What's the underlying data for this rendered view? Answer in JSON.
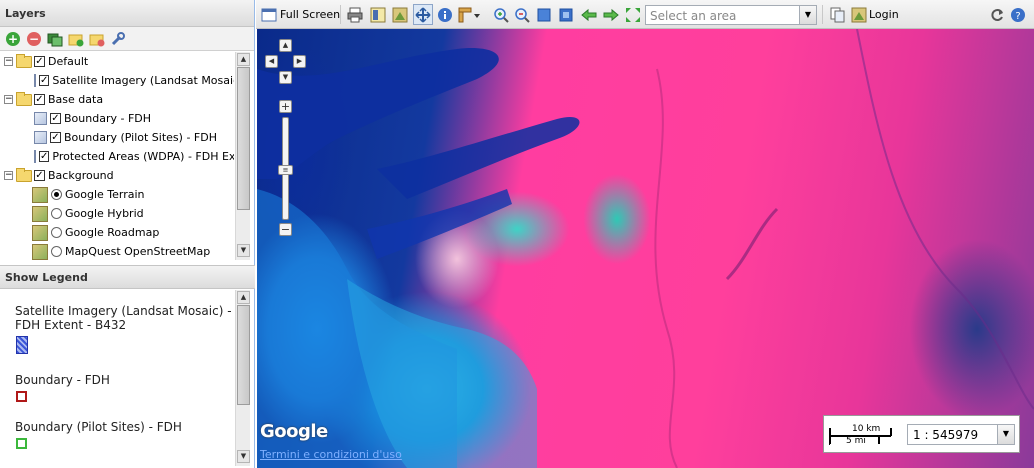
{
  "layers_panel": {
    "title": "Layers",
    "tree": {
      "default_group": "Default",
      "default_layer": "Satellite Imagery (Landsat Mosaic) - FDH Extent - B432",
      "base_group": "Base data",
      "base_layers": [
        "Boundary - FDH",
        "Boundary (Pilot Sites) - FDH",
        "Protected Areas (WDPA) - FDH Extent"
      ],
      "background_group": "Background",
      "background_layers": [
        "Google Terrain",
        "Google Hybrid",
        "Google Roadmap",
        "MapQuest OpenStreetMap"
      ]
    }
  },
  "legend_panel": {
    "title": "Show Legend",
    "entries": [
      "Satellite Imagery (Landsat Mosaic) -",
      "FDH Extent - B432",
      "Boundary - FDH",
      "Boundary (Pilot Sites) - FDH"
    ]
  },
  "toolbar": {
    "full_screen": "Full Screen",
    "area_placeholder": "Select an area",
    "login": "Login"
  },
  "map": {
    "google_logo": "Google",
    "terms_link": "Termini e condizioni d'uso",
    "scale_km": "10 km",
    "scale_mi": "5 mi",
    "scale_ratio": "1 : 545979"
  }
}
